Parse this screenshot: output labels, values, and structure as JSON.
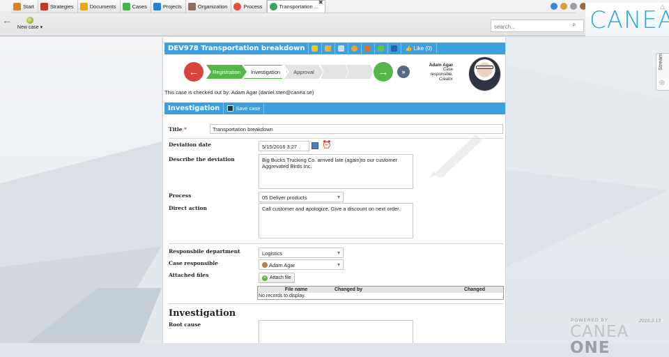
{
  "tabs": [
    {
      "label": "Start",
      "icon": "home-icon",
      "color": "#d9822b"
    },
    {
      "label": "Strategies",
      "icon": "strategies-icon",
      "color": "#c0392b"
    },
    {
      "label": "Documents",
      "icon": "documents-icon",
      "color": "#e6a817"
    },
    {
      "label": "Cases",
      "icon": "cases-icon",
      "color": "#4caf50"
    },
    {
      "label": "Projects",
      "icon": "projects-icon",
      "color": "#2a7fd4"
    },
    {
      "label": "Organization",
      "icon": "organization-icon",
      "color": "#8d6e63"
    },
    {
      "label": "Process",
      "icon": "process-icon",
      "color": "#e74c3c"
    },
    {
      "label": "Transportation ...",
      "icon": "case-icon",
      "color": "#3aa55a",
      "active": true
    }
  ],
  "toolbar": {
    "new_case_label": "New case ▾"
  },
  "search": {
    "placeholder": "search..."
  },
  "brand": {
    "logo": "CANEA",
    "color": "#2aa6e0"
  },
  "sidepanel": {
    "stream_label": "Stream"
  },
  "footer": {
    "powered_by": "POWERED BY",
    "product": "CANEA ",
    "product_bold": "ONE",
    "version": "2016.2.13"
  },
  "case": {
    "header": "DEV978 Transportation breakdown",
    "like_label": "Like",
    "like_count": "(0)",
    "tool_icons": [
      "warning-icon",
      "users-icon",
      "pen-icon",
      "clock-icon",
      "chart-icon",
      "export-icon",
      "word-icon"
    ],
    "workflow": {
      "steps": [
        "Registration",
        "Investigation",
        "Approval",
        "",
        ""
      ],
      "current": "Investigation"
    },
    "checked_out": "This case is checked out by: Adam Agar (daniel.sten@canea.se)",
    "creator": {
      "name": "Adam Agar",
      "roles": [
        "Case",
        "responsible,",
        "Creator"
      ]
    },
    "section": {
      "title": "Investigation",
      "save_label": "Save case"
    },
    "fields": {
      "title_label": "Title",
      "title_value": "Transportation breakdown",
      "deviation_date_label": "Deviation date",
      "deviation_date_value": "5/15/2016 3:27 .",
      "describe_label": "Describe the deviation",
      "describe_value": "Big Bucks Trucking Co. arrived late (again)to our customer Aggrevated Birds Inc.",
      "process_label": "Process",
      "process_value": "05 Deliver products",
      "direct_action_label": "Direct action",
      "direct_action_value": "Call customer and apologize. Give a discount on next order.",
      "dept_label": "Responsbile department",
      "dept_value": "Logistics",
      "responsible_label": "Case responsible",
      "responsible_value": "Adam Agar",
      "files_label": "Attached files",
      "attach_label": "Attach file"
    },
    "files_table": {
      "columns": [
        "File name",
        "Changed by",
        "Changed"
      ],
      "empty": "No records to display."
    },
    "investigation": {
      "heading": "Investigation",
      "root_cause_label": "Root cause"
    }
  }
}
